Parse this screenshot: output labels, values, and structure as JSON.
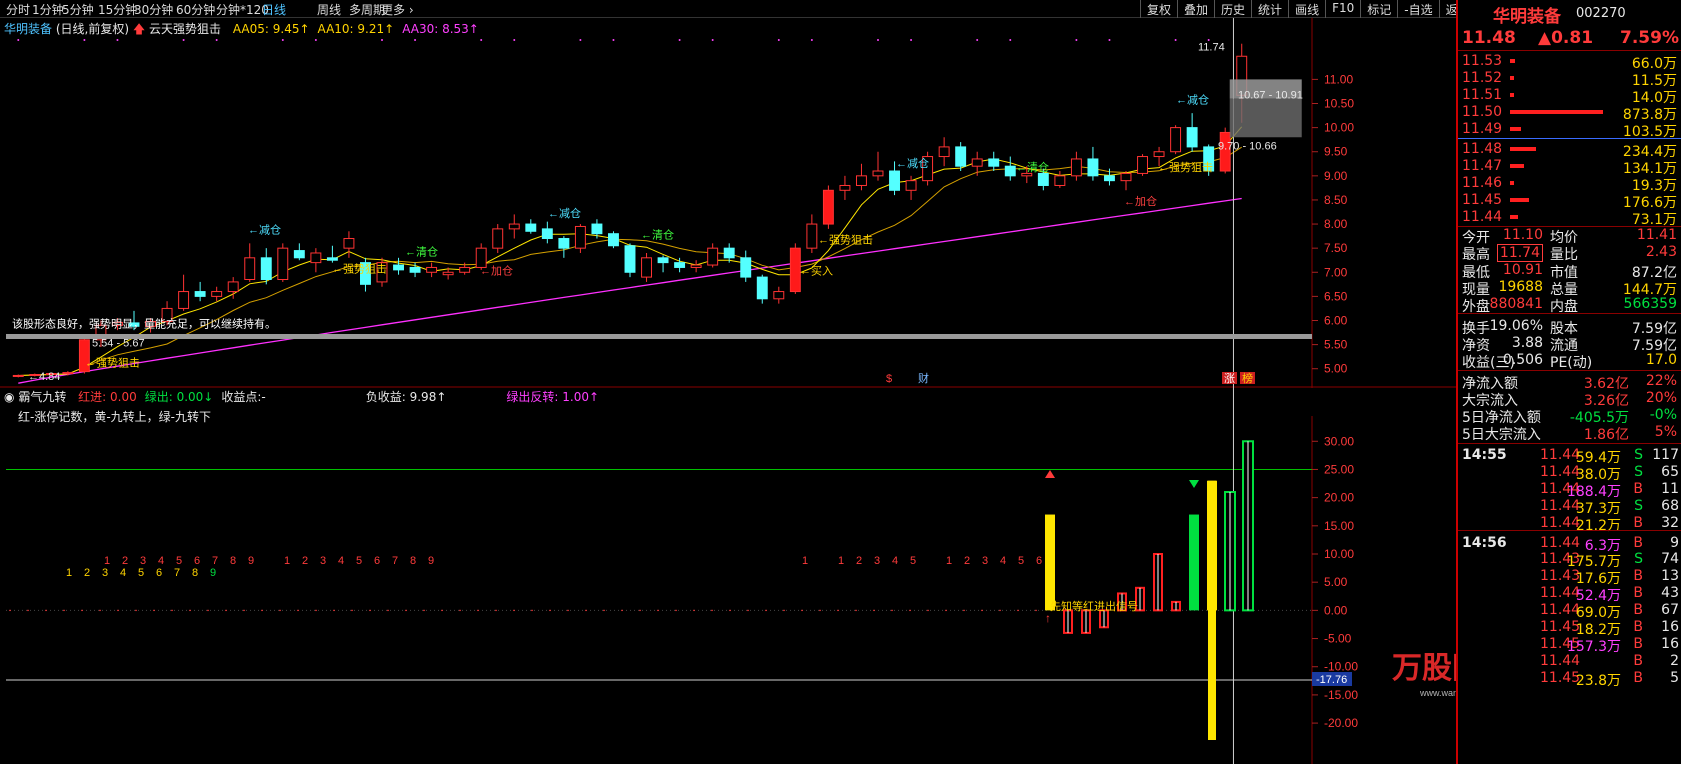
{
  "toolbar": {
    "periods": [
      "分时",
      "1分钟",
      "5分钟",
      "15分钟",
      "30分钟",
      "60分钟",
      "分钟*120",
      "日线",
      "周线",
      "多周期",
      "更多"
    ],
    "active": "日线",
    "right": [
      "复权",
      "叠加",
      "历史",
      "统计",
      "画线",
      "F10",
      "标记",
      "-自选",
      "返回"
    ]
  },
  "main": {
    "title": "华明装备",
    "mode": "(日线,前复权)",
    "indicator": "云天强势狙击",
    "ma": [
      {
        "label": "AA05: 9.45",
        "color": "#ffd400"
      },
      {
        "label": "AA10: 9.21",
        "color": "#ffd400"
      },
      {
        "label": "AA30: 8.53",
        "color": "#ff40ff"
      }
    ],
    "price_axis": [
      "11.00",
      "10.50",
      "10.00",
      "9.50",
      "9.00",
      "8.50",
      "8.00",
      "7.50",
      "7.00",
      "6.50",
      "6.00",
      "5.50",
      "5.00"
    ],
    "annotations": [
      {
        "t": "←减仓",
        "c": "#4fe0ff"
      },
      {
        "t": "←减仓",
        "c": "#4fe0ff"
      },
      {
        "t": "←减仓",
        "c": "#4fe0ff"
      },
      {
        "t": "←减仓",
        "c": "#4fe0ff"
      },
      {
        "t": "←清仓",
        "c": "#40ff40"
      },
      {
        "t": "←清仓",
        "c": "#40ff40"
      },
      {
        "t": "←清仓",
        "c": "#40ff40"
      },
      {
        "t": "←强势狙击",
        "c": "#ffd400"
      },
      {
        "t": "←强势狙击",
        "c": "#ffd400"
      },
      {
        "t": "←强势狙击",
        "c": "#ffd400"
      },
      {
        "t": "←强势狙击",
        "c": "#ffd400"
      },
      {
        "t": "←加仓",
        "c": "#ff4040"
      },
      {
        "t": "←加仓",
        "c": "#ff4040"
      },
      {
        "t": "←买入",
        "c": "#ffd400"
      },
      {
        "t": "←4.84",
        "c": "#e8e8e8"
      },
      {
        "t": "5.54 - 5.67",
        "c": "#e8e8e8"
      },
      {
        "t": "11.74",
        "c": "#e8e8e8"
      },
      {
        "t": "10.67 - 10.91",
        "c": "#e8e8e8"
      },
      {
        "t": "9.70 - 10.66",
        "c": "#e8e8e8"
      }
    ],
    "comment": "该股形态良好，强势明显，量能充足，可以继续持有。",
    "events": [
      "$",
      "财",
      "涨",
      "榜"
    ]
  },
  "sub": {
    "title": "霸气九转",
    "legend": [
      {
        "t": "红进: 0.00",
        "c": "#ff3b3b"
      },
      {
        "t": "绿出: 0.00↓",
        "c": "#00e040"
      },
      {
        "t": "收益点:-",
        "c": "#e8e8e8"
      },
      {
        "t": "负收益: 9.98↑",
        "c": "#e8e8e8"
      },
      {
        "t": "绿出反转: 1.00↑",
        "c": "#ff40ff"
      }
    ],
    "note": "红-涨停记数，黄-九转上，绿-九转下",
    "signal": "先知等红进出信号",
    "axis": [
      "30.00",
      "25.00",
      "20.00",
      "15.00",
      "10.00",
      "5.00",
      "0.00",
      "-5.00",
      "-10.00",
      "-15.00",
      "-20.00"
    ],
    "cursor_value": "-17.76",
    "digits_r": [
      "1",
      "2",
      "3",
      "4",
      "5",
      "6",
      "7",
      "8",
      "9",
      "1",
      "2",
      "3",
      "4",
      "5",
      "6",
      "7",
      "8",
      "9",
      "1",
      "1",
      "2",
      "3",
      "4",
      "5",
      "1",
      "2",
      "3",
      "4",
      "5",
      "6"
    ],
    "digits_o": [
      "1",
      "2",
      "3",
      "4",
      "5",
      "6",
      "7",
      "8",
      "9"
    ]
  },
  "quote": {
    "name": "华明装备",
    "code": "002270",
    "price": "11.48",
    "change": "▲0.81",
    "pct": "7.59%",
    "asks": [
      {
        "p": "11.53",
        "v": "66.0万",
        "w": 0.05
      },
      {
        "p": "11.52",
        "v": "11.5万",
        "w": 0.01
      },
      {
        "p": "11.51",
        "v": "14.0万",
        "w": 0.02
      },
      {
        "p": "11.50",
        "v": "873.8万",
        "w": 0.98
      },
      {
        "p": "11.49",
        "v": "103.5万",
        "w": 0.12
      }
    ],
    "bids": [
      {
        "p": "11.48",
        "v": "234.4万",
        "w": 0.27
      },
      {
        "p": "11.47",
        "v": "134.1万",
        "w": 0.15
      },
      {
        "p": "11.46",
        "v": "19.3万",
        "w": 0.02
      },
      {
        "p": "11.45",
        "v": "176.6万",
        "w": 0.2
      },
      {
        "p": "11.44",
        "v": "73.1万",
        "w": 0.08
      }
    ],
    "stats": [
      [
        "今开",
        "11.10",
        "均价",
        "11.41"
      ],
      [
        "最高",
        "11.74",
        "量比",
        "2.43"
      ],
      [
        "最低",
        "10.91",
        "市值",
        "87.2亿"
      ],
      [
        "现量",
        "19688",
        "总量",
        "144.7万"
      ],
      [
        "外盘",
        "880841",
        "内盘",
        "566359"
      ],
      [
        "换手",
        "19.06%",
        "股本",
        "7.59亿"
      ],
      [
        "净资",
        "3.88",
        "流通",
        "7.59亿"
      ],
      [
        "收益(三)",
        "0.506",
        "PE(动)",
        "17.0"
      ]
    ],
    "flows": [
      [
        "净流入额",
        "3.62亿",
        "22%"
      ],
      [
        "大宗流入",
        "3.26亿",
        "20%"
      ],
      [
        "5日净流入额",
        "-405.5万",
        "-0%"
      ],
      [
        "5日大宗流入",
        "1.86亿",
        "5%"
      ]
    ],
    "ticks": [
      {
        "time": "14:55",
        "p": "11.44",
        "v": "59.4万",
        "s": "S",
        "n": "117"
      },
      {
        "p": "11.44",
        "v": "38.0万",
        "s": "S",
        "n": "65"
      },
      {
        "p": "11.44",
        "v": "188.4万",
        "s": "B",
        "n": "11"
      },
      {
        "p": "11.44",
        "v": "37.3万",
        "s": "S",
        "n": "68"
      },
      {
        "p": "11.44",
        "v": "21.2万",
        "s": "B",
        "n": "32"
      },
      {
        "time": "14:56",
        "p": "11.44",
        "v": "6.3万",
        "s": "B",
        "n": "9"
      },
      {
        "p": "11.43",
        "v": "175.7万",
        "s": "S",
        "n": "74"
      },
      {
        "p": "11.43",
        "v": "17.6万",
        "s": "B",
        "n": "13"
      },
      {
        "p": "11.44",
        "v": "52.4万",
        "s": "B",
        "n": "43"
      },
      {
        "p": "11.44",
        "v": "69.0万",
        "s": "B",
        "n": "67"
      },
      {
        "p": "11.45",
        "v": "18.2万",
        "s": "B",
        "n": "16"
      },
      {
        "p": "11.45",
        "v": "157.3万",
        "s": "B",
        "n": "16"
      },
      {
        "p": "11.44",
        "v": "",
        "s": "B",
        "n": "2"
      },
      {
        "p": "11.45",
        "v": "23.8万",
        "s": "B",
        "n": "5"
      }
    ]
  },
  "watermark": {
    "text": "万股网",
    "url": "www.wangu.com"
  },
  "chart_data": {
    "type": "candlestick",
    "series_name": "华明装备 日K",
    "ylim": [
      4.6,
      11.9
    ],
    "candles": [
      [
        4.85,
        4.88,
        4.82,
        4.86
      ],
      [
        4.86,
        4.9,
        4.84,
        4.88
      ],
      [
        4.88,
        4.92,
        4.86,
        4.9
      ],
      [
        4.9,
        4.95,
        4.86,
        4.92
      ],
      [
        4.94,
        5.68,
        4.9,
        5.6
      ],
      [
        5.6,
        6.0,
        5.45,
        5.9
      ],
      [
        5.9,
        6.05,
        5.8,
        5.96
      ],
      [
        5.95,
        6.2,
        5.8,
        5.88
      ],
      [
        5.88,
        6.05,
        5.75,
        5.98
      ],
      [
        5.98,
        6.4,
        5.9,
        6.25
      ],
      [
        6.25,
        6.95,
        6.2,
        6.6
      ],
      [
        6.6,
        6.8,
        6.4,
        6.5
      ],
      [
        6.5,
        6.7,
        6.4,
        6.6
      ],
      [
        6.6,
        6.9,
        6.45,
        6.8
      ],
      [
        6.85,
        7.6,
        6.8,
        7.3
      ],
      [
        7.3,
        7.5,
        6.75,
        6.85
      ],
      [
        6.85,
        7.6,
        6.8,
        7.5
      ],
      [
        7.45,
        7.6,
        7.25,
        7.3
      ],
      [
        7.2,
        7.5,
        7.0,
        7.4
      ],
      [
        7.3,
        7.55,
        7.2,
        7.25
      ],
      [
        7.5,
        7.85,
        7.3,
        7.7
      ],
      [
        7.2,
        7.3,
        6.6,
        6.75
      ],
      [
        6.8,
        7.3,
        6.7,
        7.2
      ],
      [
        7.15,
        7.3,
        6.95,
        7.05
      ],
      [
        7.1,
        7.2,
        6.9,
        7.0
      ],
      [
        7.0,
        7.2,
        6.9,
        7.1
      ],
      [
        6.95,
        7.1,
        6.85,
        7.0
      ],
      [
        7.0,
        7.2,
        6.95,
        7.1
      ],
      [
        7.1,
        7.6,
        7.05,
        7.5
      ],
      [
        7.5,
        8.0,
        7.4,
        7.9
      ],
      [
        7.9,
        8.2,
        7.7,
        8.0
      ],
      [
        8.0,
        8.1,
        7.8,
        7.85
      ],
      [
        7.9,
        8.05,
        7.6,
        7.7
      ],
      [
        7.7,
        7.75,
        7.3,
        7.5
      ],
      [
        7.5,
        8.0,
        7.4,
        7.95
      ],
      [
        8.0,
        8.1,
        7.7,
        7.8
      ],
      [
        7.8,
        7.85,
        7.5,
        7.55
      ],
      [
        7.55,
        7.6,
        6.9,
        7.0
      ],
      [
        6.9,
        7.4,
        6.8,
        7.3
      ],
      [
        7.3,
        7.35,
        7.0,
        7.2
      ],
      [
        7.2,
        7.3,
        7.0,
        7.1
      ],
      [
        7.1,
        7.25,
        7.0,
        7.15
      ],
      [
        7.15,
        7.6,
        7.1,
        7.5
      ],
      [
        7.5,
        7.6,
        7.2,
        7.3
      ],
      [
        7.3,
        7.45,
        6.8,
        6.9
      ],
      [
        6.9,
        6.95,
        6.35,
        6.45
      ],
      [
        6.45,
        6.7,
        6.35,
        6.6
      ],
      [
        6.6,
        7.6,
        6.55,
        7.5
      ],
      [
        7.5,
        8.2,
        7.4,
        8.0
      ],
      [
        8.0,
        8.8,
        7.9,
        8.7
      ],
      [
        8.7,
        9.0,
        8.5,
        8.8
      ],
      [
        8.8,
        9.25,
        8.7,
        9.0
      ],
      [
        9.0,
        9.5,
        8.9,
        9.1
      ],
      [
        9.1,
        9.3,
        8.6,
        8.7
      ],
      [
        8.7,
        9.0,
        8.5,
        8.9
      ],
      [
        8.9,
        9.5,
        8.8,
        9.4
      ],
      [
        9.4,
        9.8,
        9.2,
        9.6
      ],
      [
        9.6,
        9.7,
        9.1,
        9.2
      ],
      [
        9.2,
        9.5,
        9.0,
        9.35
      ],
      [
        9.35,
        9.5,
        9.1,
        9.2
      ],
      [
        9.2,
        9.4,
        8.9,
        9.0
      ],
      [
        9.0,
        9.2,
        8.85,
        9.05
      ],
      [
        9.05,
        9.15,
        8.7,
        8.8
      ],
      [
        8.8,
        9.1,
        8.75,
        9.0
      ],
      [
        9.0,
        9.5,
        8.9,
        9.35
      ],
      [
        9.35,
        9.6,
        8.9,
        9.0
      ],
      [
        9.0,
        9.15,
        8.8,
        8.9
      ],
      [
        8.9,
        9.1,
        8.7,
        9.05
      ],
      [
        9.05,
        9.45,
        9.0,
        9.4
      ],
      [
        9.4,
        9.6,
        9.2,
        9.5
      ],
      [
        9.5,
        10.05,
        9.45,
        10.0
      ],
      [
        10.0,
        10.3,
        9.5,
        9.6
      ],
      [
        9.6,
        9.65,
        9.0,
        9.1
      ],
      [
        9.1,
        10.0,
        9.05,
        9.9
      ],
      [
        10.67,
        11.74,
        10.1,
        11.48
      ]
    ],
    "ma5_end": 9.45,
    "ma10_end": 9.21,
    "ma30_end": 8.53,
    "sub_bars": [
      {
        "i": 57,
        "v": 17,
        "c": "yellow"
      },
      {
        "i": 58,
        "v": -4,
        "c": "red"
      },
      {
        "i": 59,
        "v": -4,
        "c": "red"
      },
      {
        "i": 60,
        "v": -3,
        "c": "red"
      },
      {
        "i": 61,
        "v": 3,
        "c": "red"
      },
      {
        "i": 62,
        "v": 4,
        "c": "red"
      },
      {
        "i": 63,
        "v": 10,
        "c": "red"
      },
      {
        "i": 64,
        "v": 1.5,
        "c": "red"
      },
      {
        "i": 65,
        "v": 17,
        "c": "green"
      },
      {
        "i": 66,
        "v": 23,
        "c": "yellow"
      },
      {
        "i": 67,
        "v": 21,
        "c": "green"
      },
      {
        "i": 68,
        "v": 30,
        "c": "green"
      }
    ]
  }
}
